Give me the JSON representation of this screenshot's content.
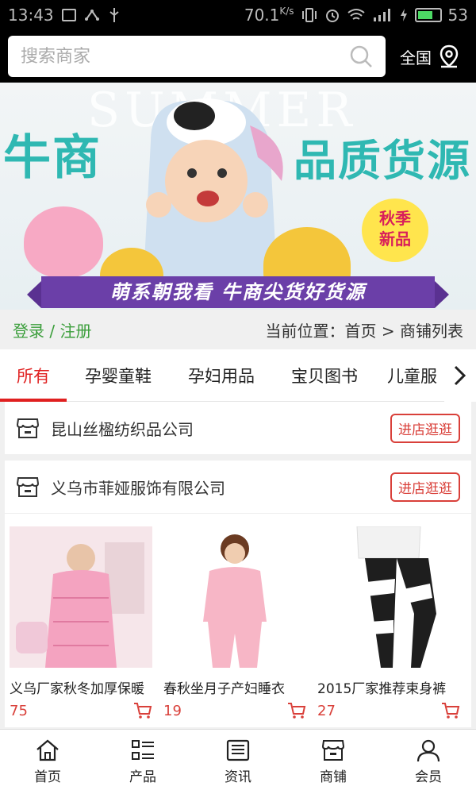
{
  "status_bar": {
    "time": "13:43",
    "net_speed": "70.1",
    "battery": "53"
  },
  "search": {
    "placeholder": "搜索商家",
    "region": "全国"
  },
  "banner": {
    "summer_text": "SUMMER",
    "left_title": "牛商",
    "right_title": "品质货源",
    "bubble_line1": "秋季",
    "bubble_line2": "新品",
    "ribbon": "萌系朝我看   牛商尖货好货源"
  },
  "breadcrumb": {
    "login": "登录 / 注册",
    "location": "当前位置：首页 > 商铺列表"
  },
  "tabs": [
    {
      "label": "所有",
      "active": true
    },
    {
      "label": "孕婴童鞋"
    },
    {
      "label": "孕妇用品"
    },
    {
      "label": "宝贝图书"
    },
    {
      "label": "儿童服"
    }
  ],
  "shops": [
    {
      "name": "昆山丝楹纺织品公司",
      "button": "进店逛逛"
    },
    {
      "name": "义乌市菲娅服饰有限公司",
      "button": "进店逛逛",
      "products": [
        {
          "name": "义乌厂家秋冬加厚保暖",
          "price": "75"
        },
        {
          "name": "春秋坐月子产妇睡衣",
          "price": "19"
        },
        {
          "name": "2015厂家推荐束身裤",
          "price": "27"
        }
      ]
    }
  ],
  "bottom_nav": [
    {
      "label": "首页",
      "icon": "home-icon"
    },
    {
      "label": "产品",
      "icon": "list-icon"
    },
    {
      "label": "资讯",
      "icon": "news-icon"
    },
    {
      "label": "商铺",
      "icon": "shop-icon"
    },
    {
      "label": "会员",
      "icon": "user-icon"
    }
  ],
  "colors": {
    "accent": "#e02020",
    "login_green": "#3b9e3b",
    "banner_teal": "#2fb8b2"
  }
}
